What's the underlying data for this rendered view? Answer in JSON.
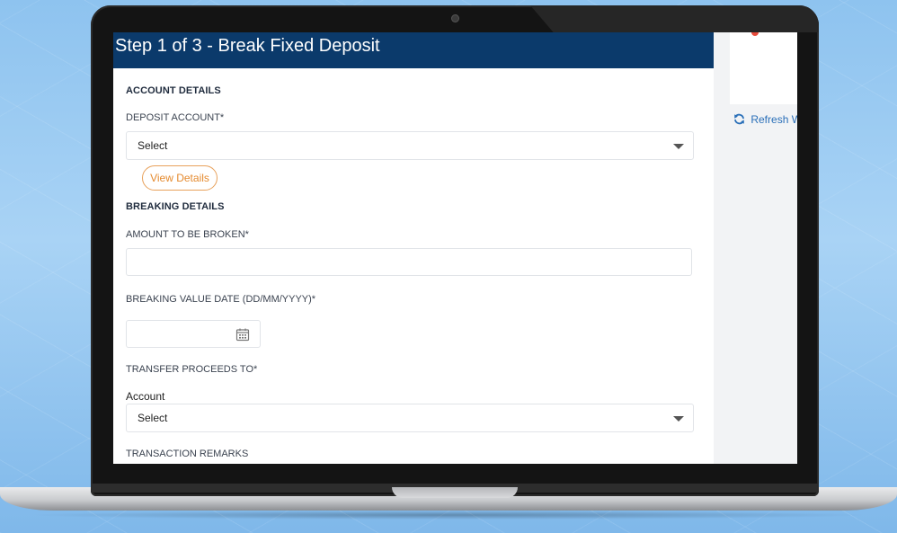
{
  "page": {
    "title": "Step 1 of 3 - Break Fixed Deposit"
  },
  "account_details": {
    "heading": "ACCOUNT DETAILS",
    "deposit_account_label": "DEPOSIT ACCOUNT*",
    "deposit_account_value": "Select",
    "view_details_label": "View Details"
  },
  "breaking_details": {
    "heading": "BREAKING DETAILS",
    "amount_label": "AMOUNT TO BE BROKEN*",
    "amount_value": "",
    "date_label": "BREAKING VALUE DATE (DD/MM/YYYY)*",
    "date_value": "",
    "transfer_label": "TRANSFER PROCEEDS TO*",
    "account_label": "Account",
    "account_value": "Select",
    "remarks_label": "TRANSACTION REMARKS"
  },
  "side_panel": {
    "refresh_label": "Refresh W"
  },
  "icons": {
    "dropdown": "chevron-down-icon",
    "calendar": "calendar-icon",
    "refresh": "refresh-icon"
  },
  "colors": {
    "header_bg": "#0b3a6b",
    "accent_orange": "#e58a2e",
    "link_blue": "#2a6fb8",
    "background": "#a9d3f5"
  }
}
